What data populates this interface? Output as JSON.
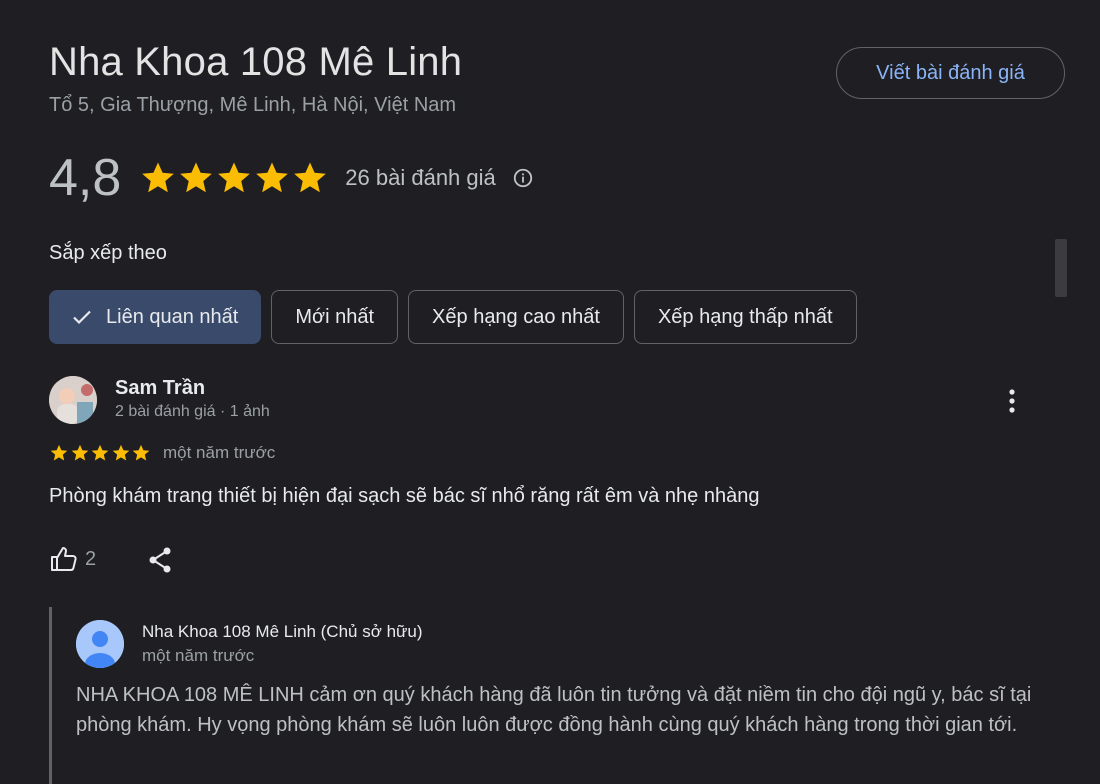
{
  "business": {
    "name": "Nha Khoa 108 Mê Linh",
    "address": "Tổ 5, Gia Thượng, Mê Linh, Hà Nội, Việt Nam",
    "write_review_label": "Viết bài đánh giá"
  },
  "rating": {
    "value": "4,8",
    "stars": 5,
    "count_label": "26 bài đánh giá",
    "star_color": "#fbbc04"
  },
  "sort": {
    "label": "Sắp xếp theo",
    "options": [
      "Liên quan nhất",
      "Mới nhất",
      "Xếp hạng cao nhất",
      "Xếp hạng thấp nhất"
    ],
    "selected": "Liên quan nhất"
  },
  "review": {
    "author": "Sam Trần",
    "meta": "2 bài đánh giá · 1 ảnh",
    "stars": 5,
    "date": "một năm trước",
    "text": "Phòng khám trang thiết bị hiện đại sạch sẽ bác sĩ nhổ răng rất êm và nhẹ nhàng",
    "likes": "2"
  },
  "owner_reply": {
    "author": "Nha Khoa 108 Mê Linh (Chủ sở hữu)",
    "date": "một năm trước",
    "text": "NHA KHOA 108 MÊ LINH cảm ơn quý khách hàng đã luôn tin tưởng và đặt niềm tin cho đội ngũ y, bác sĩ tại phòng khám. Hy vọng phòng khám sẽ luôn luôn được đồng hành cùng quý khách hàng trong thời gian tới."
  },
  "colors": {
    "background": "#1f1f23",
    "accent": "#8ab4f8",
    "chip_selected": "#394a6b"
  }
}
